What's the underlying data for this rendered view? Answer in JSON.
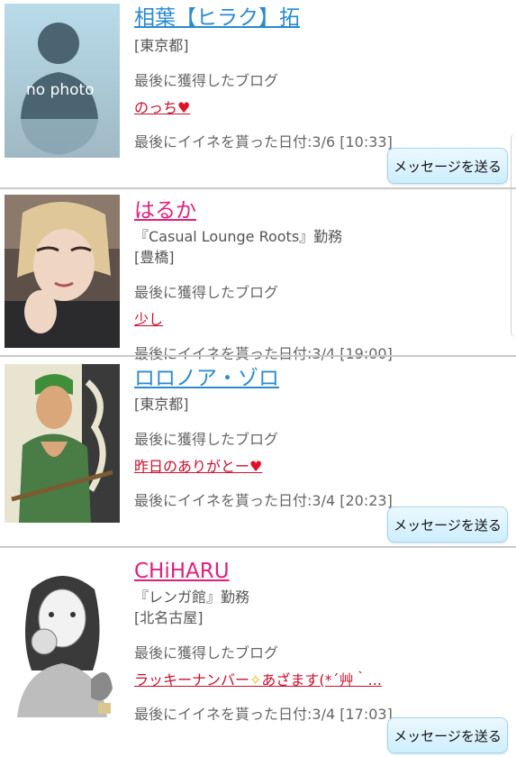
{
  "members": [
    {
      "name": "相葉【ヒラク】拓",
      "gender": "male",
      "workplace": "",
      "area": "[東京都]",
      "blog_label": "最後に獲得したブログ",
      "blog_title": "のっち",
      "blog_suffix_icon": "heart-icon",
      "last_like": "最後にイイネを貰った日付:3/6 [10:33]",
      "thumb_text": "no photo",
      "has_message_button": true
    },
    {
      "name": "はるか",
      "gender": "female",
      "workplace": "『Casual Lounge Roots』勤務",
      "area": "[豊橋]",
      "blog_label": "最後に獲得したブログ",
      "blog_title": "少し",
      "last_like": "最後にイイネを貰った日付:3/4 [19:00]",
      "has_message_button": false
    },
    {
      "name": "ロロノア・ゾロ",
      "gender": "male",
      "workplace": "",
      "area": "[東京都]",
      "blog_label": "最後に獲得したブログ",
      "blog_title": "昨日のありがとー",
      "blog_suffix_icon": "heart-icon",
      "last_like": "最後にイイネを貰った日付:3/4 [20:23]",
      "has_message_button": true
    },
    {
      "name": "CHiHARU",
      "gender": "female",
      "workplace": "『レンガ館』勤務",
      "area": "[北名古屋]",
      "blog_label": "最後に獲得したブログ",
      "blog_title_a": "ラッキーナンバー",
      "blog_title_b": "あざます(*´艸｀...",
      "last_like": "最後にイイネを貰った日付:3/4 [17:03]",
      "has_message_button": true
    }
  ],
  "message_button_label": "メッセージを送る",
  "colors": {
    "male_name": "#2a8ad0",
    "female_name": "#e0207a",
    "blog_link": "#c8102e",
    "button_bg": "#cdeefd",
    "divider": "#c9c9c9"
  }
}
